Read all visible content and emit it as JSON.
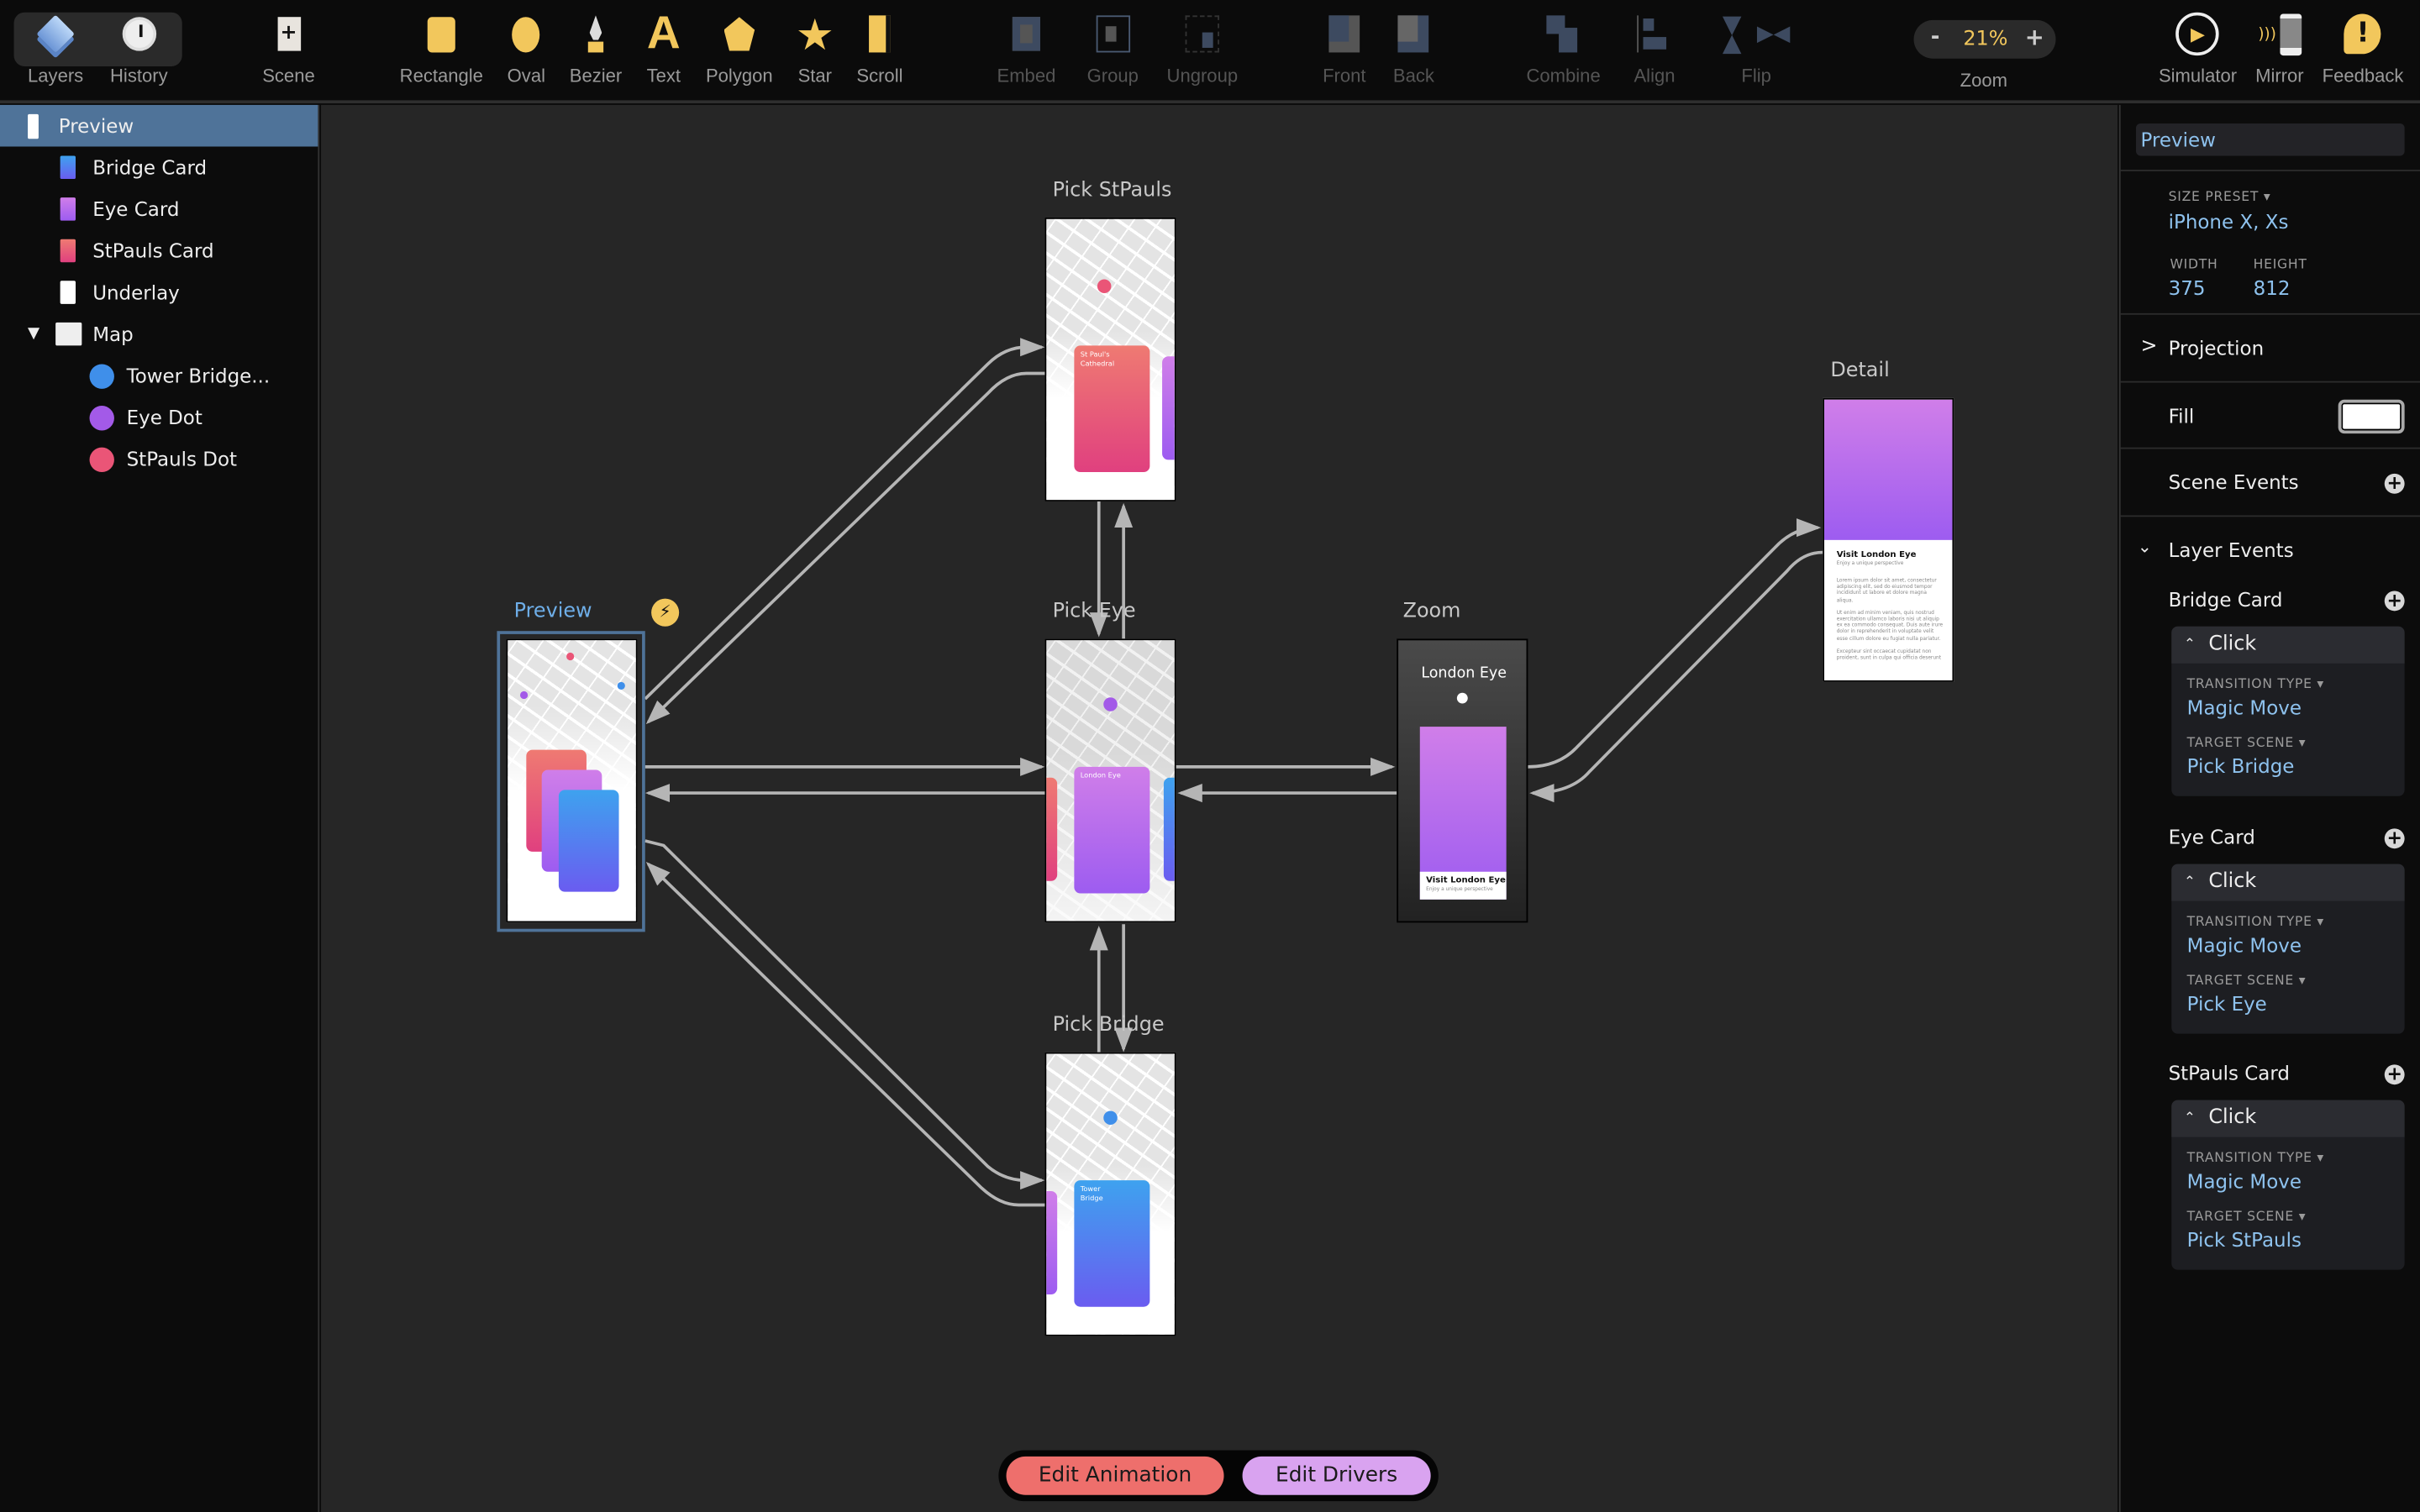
{
  "toolbar": {
    "layers": "Layers",
    "history": "History",
    "scene": "Scene",
    "tools": [
      "Rectangle",
      "Oval",
      "Bezier",
      "Text",
      "Polygon",
      "Star",
      "Scroll"
    ],
    "arrange": [
      "Embed",
      "Group",
      "Ungroup",
      "Front",
      "Back",
      "Combine",
      "Align",
      "Flip"
    ],
    "zoom": {
      "value": "21%",
      "label": "Zoom",
      "minus": "-",
      "plus": "+"
    },
    "right": [
      "Simulator",
      "Mirror",
      "Feedback"
    ],
    "accent": "#f2c75c"
  },
  "layers": [
    {
      "label": "Preview",
      "icon": "scene-thumb",
      "selected": true
    },
    {
      "label": "Bridge Card",
      "icon": "blue-card-thumb"
    },
    {
      "label": "Eye Card",
      "icon": "purple-card-thumb"
    },
    {
      "label": "StPauls Card",
      "icon": "pink-card-thumb"
    },
    {
      "label": "Underlay",
      "icon": "white-rect-thumb"
    },
    {
      "label": "Map",
      "icon": "map-thumb",
      "expanded": true
    },
    {
      "label": "Tower Bridge...",
      "icon": "blue-dot",
      "color": "#3f8fea"
    },
    {
      "label": "Eye Dot",
      "icon": "purple-dot",
      "color": "#a35ae8"
    },
    {
      "label": "StPauls Dot",
      "icon": "pink-dot",
      "color": "#ea5577"
    }
  ],
  "scenes": {
    "stpauls": {
      "label": "Pick StPauls",
      "card": "St Paul's Cathedral"
    },
    "eye": {
      "label": "Pick Eye",
      "card": "London Eye"
    },
    "bridge": {
      "label": "Pick Bridge",
      "card": "Tower Bridge"
    },
    "preview": {
      "label": "Preview"
    },
    "zoom": {
      "label": "Zoom",
      "title": "London Eye",
      "card_title": "Visit London Eye",
      "card_sub": "Enjoy a unique perspective"
    },
    "detail": {
      "label": "Detail",
      "title": "Visit London Eye",
      "sub": "Enjoy a unique perspective",
      "p1": "Lorem ipsum dolor sit amet, consectetur adipiscing elit, sed do eiusmod tempor incididunt ut labore et dolore magna aliqua.",
      "p2": "Ut enim ad minim veniam, quis nostrud exercitation ullamco laboris nisi ut aliquip ex ea commodo consequat. Duis aute irure dolor in reprehenderit in voluptate velit esse cillum dolore eu fugiat nulla pariatur.",
      "p3": "Excepteur sint occaecat cupidatat non proident, sunt in culpa qui officia deserunt"
    }
  },
  "inspector": {
    "name": "Preview",
    "size_preset_label": "SIZE PRESET",
    "size_preset": "iPhone X, Xs",
    "width_label": "WIDTH",
    "width": "375",
    "height_label": "HEIGHT",
    "height": "812",
    "projection": "Projection",
    "fill": "Fill",
    "fill_color": "#ffffff",
    "scene_events": "Scene Events",
    "layer_events": "Layer Events",
    "events": [
      {
        "layer": "Bridge Card",
        "trigger": "Click",
        "type_label": "TRANSITION TYPE",
        "type": "Magic Move",
        "target_label": "TARGET SCENE",
        "target": "Pick Bridge"
      },
      {
        "layer": "Eye Card",
        "trigger": "Click",
        "type_label": "TRANSITION TYPE",
        "type": "Magic Move",
        "target_label": "TARGET SCENE",
        "target": "Pick Eye"
      },
      {
        "layer": "StPauls Card",
        "trigger": "Click",
        "type_label": "TRANSITION TYPE",
        "type": "Magic Move",
        "target_label": "TARGET SCENE",
        "target": "Pick StPauls"
      }
    ]
  },
  "bottom": {
    "edit_animation": "Edit Animation",
    "edit_drivers": "Edit Drivers",
    "animation_color": "#ee6f6c",
    "drivers_color": "#d9a3f0"
  }
}
